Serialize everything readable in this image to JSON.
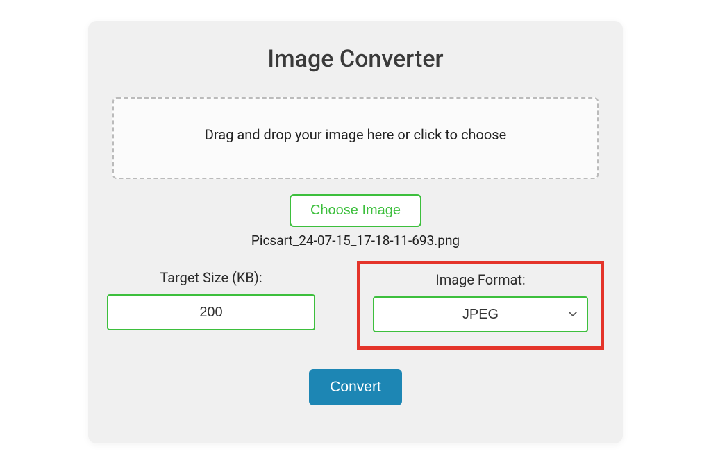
{
  "title": "Image Converter",
  "dropzone": {
    "text": "Drag and drop your image here or click to choose"
  },
  "choose_button": "Choose Image",
  "selected_filename": "Picsart_24-07-15_17-18-11-693.png",
  "fields": {
    "target_size": {
      "label": "Target Size (KB):",
      "value": "200"
    },
    "image_format": {
      "label": "Image Format:",
      "value": "JPEG"
    }
  },
  "convert_button": "Convert"
}
